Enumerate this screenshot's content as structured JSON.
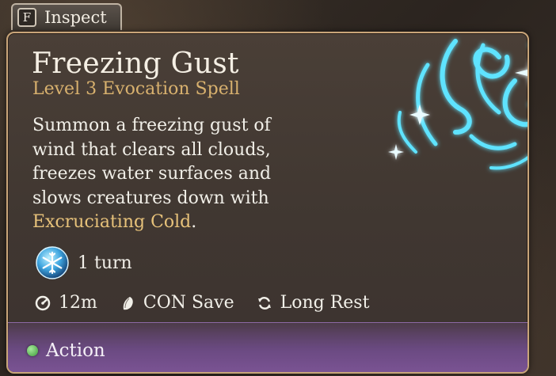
{
  "inspect": {
    "key": "F",
    "label": "Inspect"
  },
  "spell": {
    "name": "Freezing Gust",
    "subtitle": "Level 3 Evocation Spell",
    "description_lines": [
      "Summon a freezing gust of",
      "wind that clears all clouds,",
      "freezes water surfaces and",
      "slows creatures down with"
    ],
    "description_highlight": "Excruciating Cold",
    "description_end": ".",
    "duration": "1 turn",
    "stats": {
      "range": "12m",
      "save": "CON Save",
      "recharge": "Long Rest"
    },
    "cost": "Action"
  },
  "icons": {
    "inspect_key": "key-f-icon",
    "spell_art": "freezing-gust-art",
    "duration": "frost-snowflake-icon",
    "range": "range-gauge-icon",
    "save": "shield-save-icon",
    "recharge": "long-rest-recharge-icon",
    "cost": "action-dot-icon"
  },
  "colors": {
    "title": "#f5efe4",
    "subtitle": "#d8b16e",
    "border": "#c9a579",
    "frost": "#44d5ff",
    "action": "#3e9b3a",
    "footer": "#7a5393"
  }
}
